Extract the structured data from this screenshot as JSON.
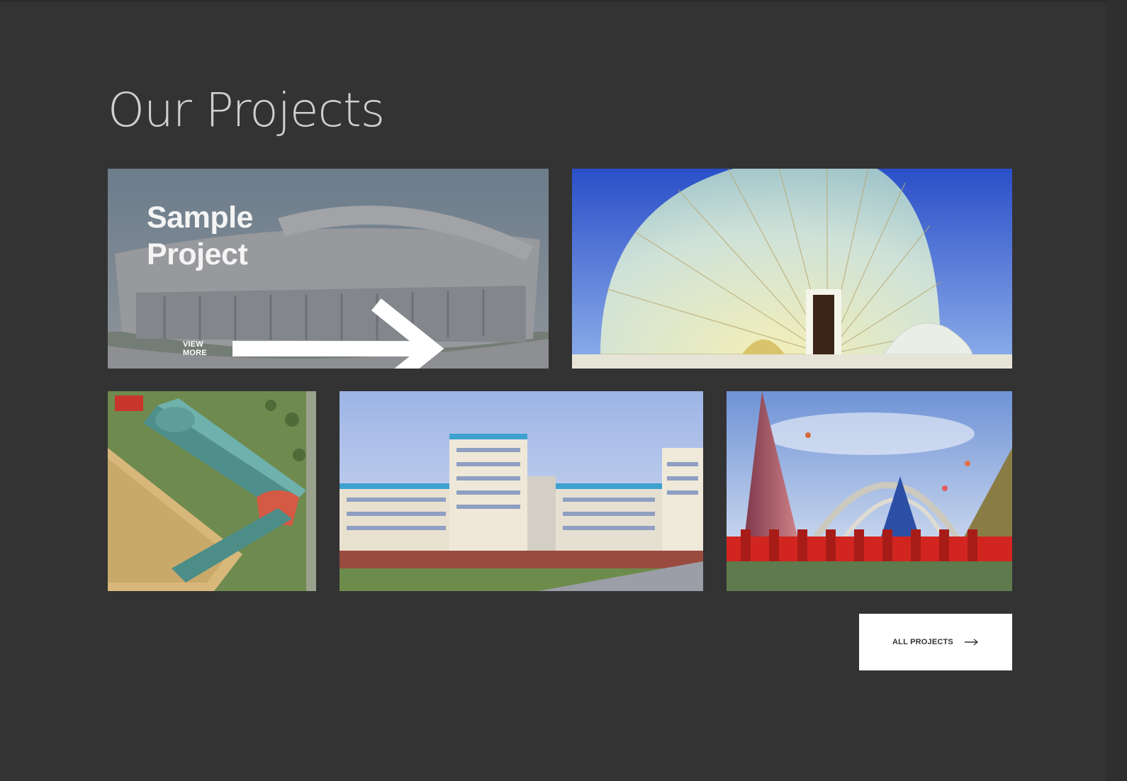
{
  "section": {
    "title": "Our Projects"
  },
  "featured": {
    "title": "Sample Project",
    "link_label": "VIEW MORE",
    "link_icon": "arrow-right-icon"
  },
  "projects": [
    {
      "image": "stadium-render"
    },
    {
      "image": "fan-dome-render"
    },
    {
      "image": "aerial-complex-render"
    },
    {
      "image": "residential-towers-render"
    },
    {
      "image": "pyramid-arch-render"
    }
  ],
  "footer": {
    "all_label": "ALL PROJECTS",
    "icon": "arrow-right-icon"
  },
  "colors": {
    "background": "#333333",
    "title": "#cfcfcf",
    "button_bg": "#ffffff",
    "button_text": "#333333"
  }
}
